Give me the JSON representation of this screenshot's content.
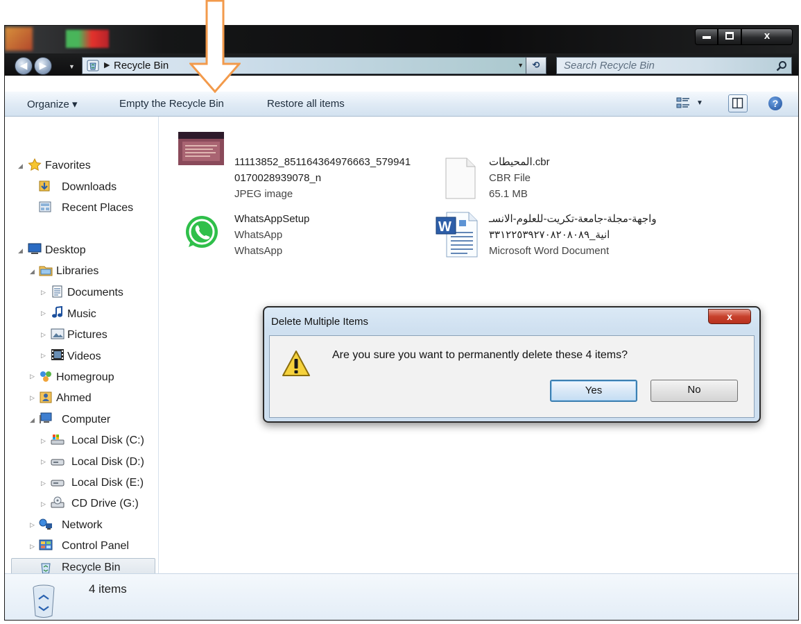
{
  "window": {
    "caption_buttons": {
      "minimize": "",
      "maximize": "",
      "close": "x"
    }
  },
  "address_bar": {
    "location": "Recycle Bin",
    "search_placeholder": "Search Recycle Bin"
  },
  "toolbar": {
    "organize_label": "Organize ▾",
    "empty_label": "Empty the Recycle Bin",
    "restore_label": "Restore all items"
  },
  "nav_tree": {
    "favorites": "Favorites",
    "downloads": "Downloads",
    "recent_places": "Recent Places",
    "desktop": "Desktop",
    "libraries": "Libraries",
    "documents": "Documents",
    "music": "Music",
    "pictures": "Pictures",
    "videos": "Videos",
    "homegroup": "Homegroup",
    "ahmed": "Ahmed",
    "computer": "Computer",
    "local_c": "Local Disk (C:)",
    "local_d": "Local Disk (D:)",
    "local_e": "Local Disk (E:)",
    "cd_drive": "CD Drive (G:)",
    "network": "Network",
    "control_panel": "Control Panel",
    "recycle_bin": "Recycle Bin"
  },
  "files": [
    {
      "line1": "11113852_851164364976663_579941",
      "line2": "0170028939078_n",
      "line3": "JPEG image"
    },
    {
      "line1": "المحيطات.cbr",
      "line2": "CBR File",
      "line3": "65.1 MB"
    },
    {
      "line1": "WhatsAppSetup",
      "line2": "WhatsApp",
      "line3": "WhatsApp"
    },
    {
      "line1": "واجهة-مجلة-جامعة-تكريت-للعلوم-الانسـ",
      "line2": "انية_٣٣١٢٢٥٣٩٢٧٠٨٢٠٨٠٨٩",
      "line3": "Microsoft Word Document"
    }
  ],
  "details": {
    "count": "4 items"
  },
  "dialog": {
    "title": "Delete Multiple Items",
    "close": "x",
    "message": "Are you sure you want to permanently delete these 4 items?",
    "yes": "Yes",
    "no": "No"
  },
  "colors": {
    "arrow": "#f29a4b",
    "dialog_close": "#c7412c",
    "yes_border": "#3c7fb1"
  }
}
